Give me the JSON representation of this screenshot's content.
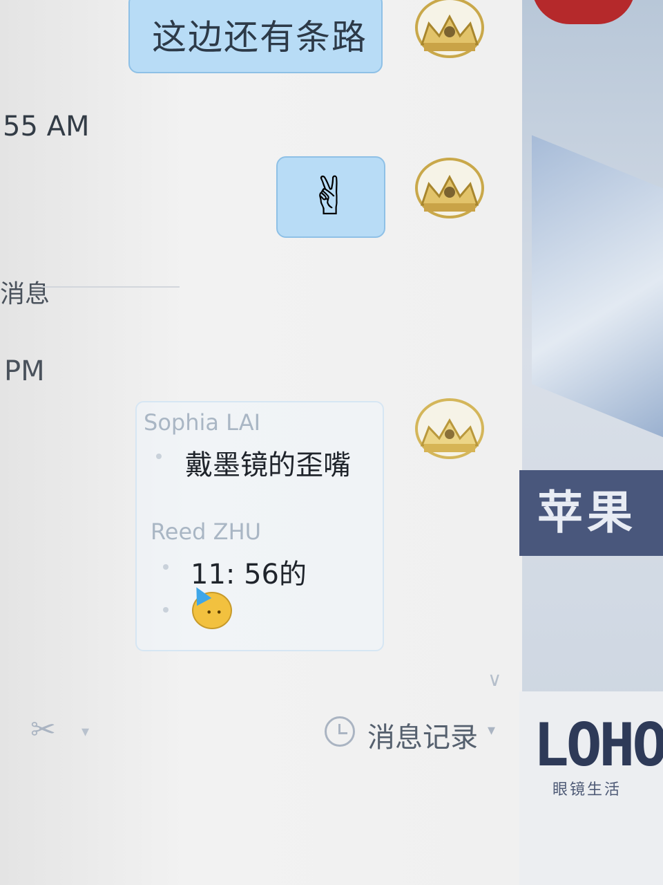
{
  "messages": {
    "sent_text": "这边还有条路",
    "sent_emoji": "✌",
    "time_1": "55 AM",
    "system_label": "消息",
    "time_2": "PM"
  },
  "quote_card": {
    "author_1": "Sophia LAI",
    "message_1": "戴墨镜的歪嘴",
    "author_2": "Reed ZHU",
    "message_2": "11: 56的"
  },
  "toolbar": {
    "cut_icon": "✂",
    "history_label": "消息记录",
    "chevron": "▾"
  },
  "side_panel": {
    "banner_text": "苹果",
    "logo_text": "LOHO",
    "logo_subtext": "眼镜生活"
  },
  "colors": {
    "bubble": "#b8dcf6",
    "bubble_border": "#8ec0e6",
    "banner": "#49577c",
    "logo": "#2e3a58"
  },
  "icons": [
    "crown-avatar-icon",
    "peace-hand-icon",
    "party-face-icon",
    "scissors-icon",
    "clock-icon"
  ]
}
